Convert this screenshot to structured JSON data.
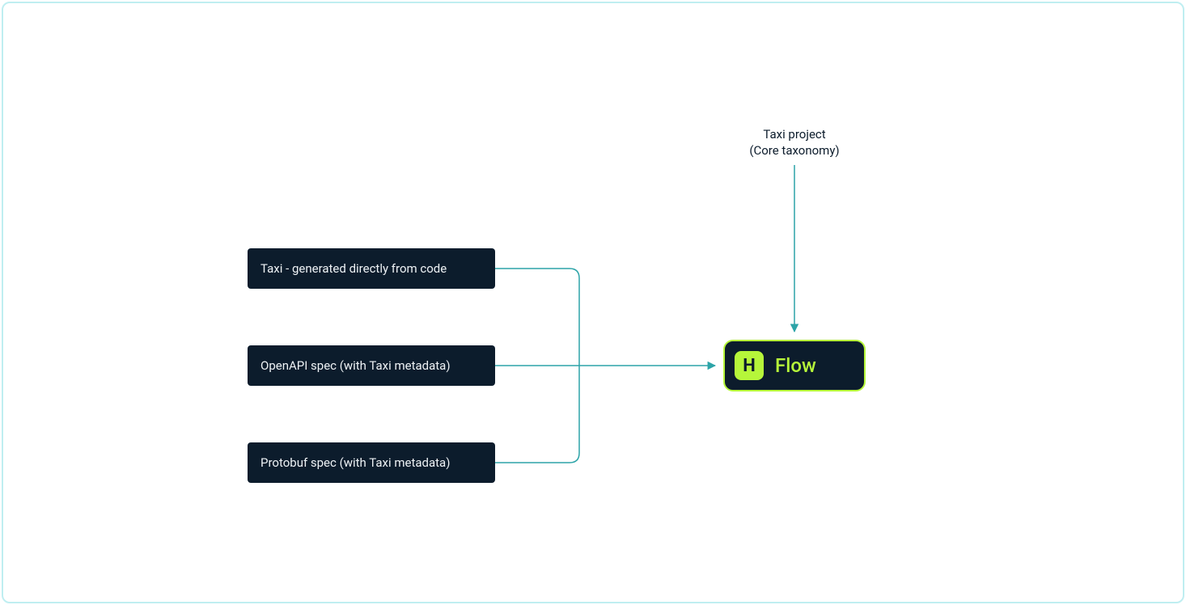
{
  "top_label": {
    "line1": "Taxi project",
    "line2": "(Core taxonomy)"
  },
  "sources": {
    "box1": "Taxi - generated directly from code",
    "box2": "OpenAPI spec (with Taxi metadata)",
    "box3": "Protobuf spec (with Taxi metadata)"
  },
  "flow": {
    "icon_letter": "H",
    "label": "Flow"
  },
  "colors": {
    "border": "#bfeef1",
    "box_bg": "#0c1c2c",
    "box_text": "#eef2f5",
    "accent": "#b6f63a",
    "connector": "#2da4a8"
  }
}
